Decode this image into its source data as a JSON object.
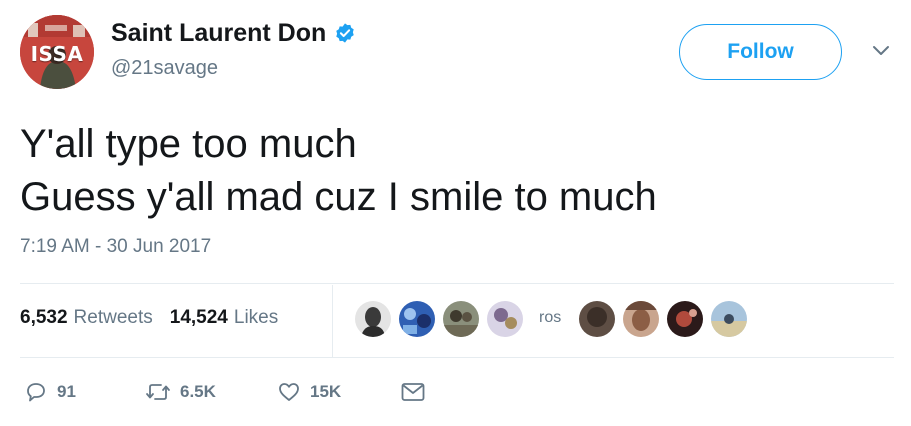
{
  "author": {
    "display_name": "Saint Laurent Don",
    "handle": "@21savage",
    "avatar_text": "ISSA",
    "verified_icon": "verified-badge-icon"
  },
  "follow_label": "Follow",
  "tweet": {
    "lines": [
      "Y'all type too much",
      "Guess y'all mad cuz I smile to much"
    ],
    "timestamp": "7:19 AM - 30 Jun 2017"
  },
  "stats": {
    "retweets_count": "6,532",
    "retweets_label": "Retweets",
    "likes_count": "14,524",
    "likes_label": "Likes"
  },
  "likers": {
    "text_avatar": "ros"
  },
  "actions": {
    "reply_count": "91",
    "retweet_count": "6.5K",
    "like_count": "15K"
  },
  "colors": {
    "link_blue": "#1da1f2",
    "secondary_text": "#657786",
    "primary_text": "#14171a",
    "divider": "#e6ecf0"
  }
}
